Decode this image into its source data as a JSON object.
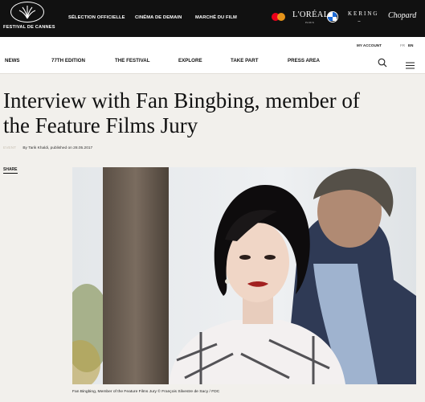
{
  "header": {
    "logo_text": "FESTIVAL DE CANNES",
    "logo_icon": "palm-icon",
    "nav": [
      "SÉLECTION OFFICIELLE",
      "CINÉMA DE DEMAIN",
      "MARCHÉ DU FILM"
    ],
    "sponsors": {
      "loreal": "L'ORÉAL",
      "loreal_sub": "PARIS",
      "kering": "KERING",
      "chopard": "Chopard"
    }
  },
  "navbar": {
    "my_account": "MY ACCOUNT",
    "lang_fr": "FR",
    "lang_en": "EN",
    "items": [
      "NEWS",
      "77TH EDITION",
      "THE FESTIVAL",
      "EXPLORE",
      "TAKE PART",
      "PRESS AREA"
    ],
    "icons": [
      "search-icon",
      "menu-icon"
    ]
  },
  "article": {
    "title": "Interview with Fan Bingbing, member of the Feature Films Jury",
    "category": "Event",
    "byline": "By Tarik Khaldi, published on 28.05.2017",
    "share": "SHARE",
    "caption": "Fan Bingbing, Member of the Feature Films Jury © François Silvestre de Sacy / FDC"
  },
  "colors": {
    "topbar": "#111111",
    "page_bg": "#f2f0ec",
    "category": "#c9c2b5"
  }
}
